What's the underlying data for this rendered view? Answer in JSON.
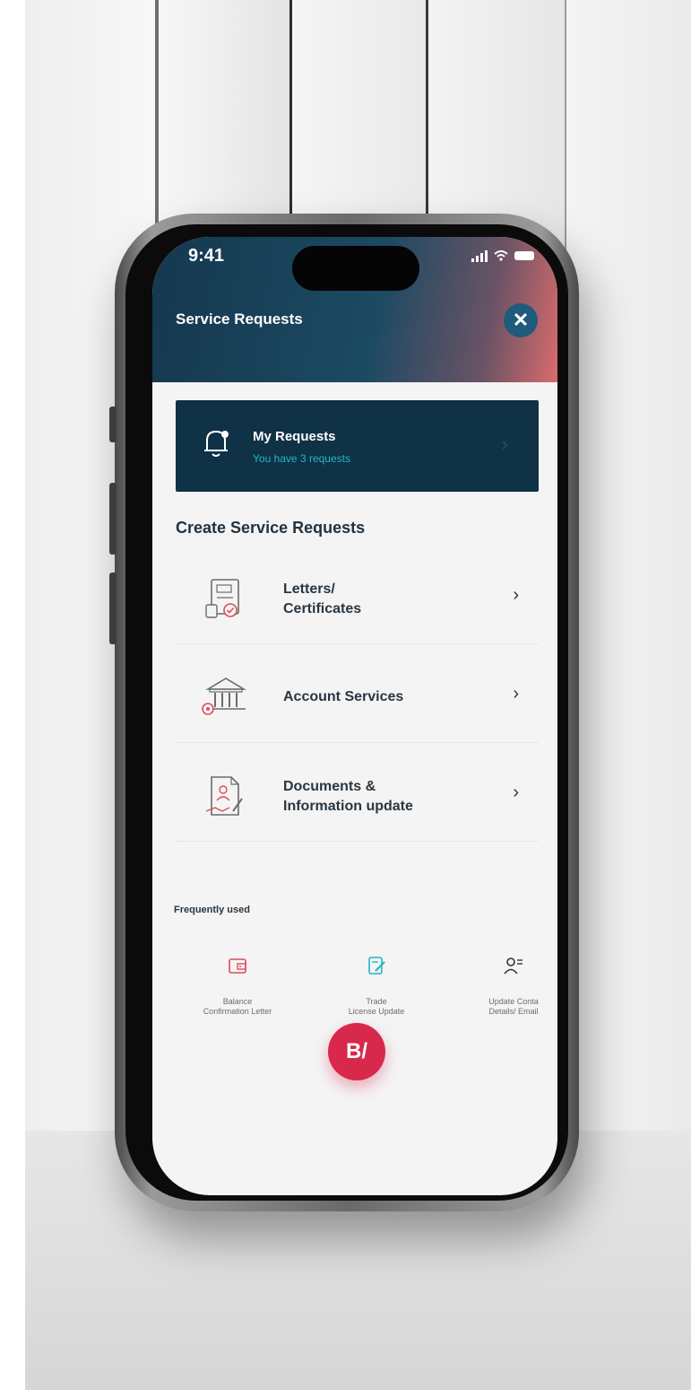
{
  "status_bar": {
    "time": "9:41"
  },
  "header": {
    "title": "Service Requests",
    "close_label": "✕"
  },
  "my_requests": {
    "title": "My Requests",
    "subtitle": "You have 3 requests",
    "chevron": "›"
  },
  "create_section": {
    "title": "Create Service Requests",
    "items": [
      {
        "label_line1": "Letters/",
        "label_line2": "Certificates",
        "icon": "certificate-icon"
      },
      {
        "label_line1": "Account Services",
        "label_line2": "",
        "icon": "bank-icon"
      },
      {
        "label_line1": "Documents &",
        "label_line2": "Information update",
        "icon": "document-edit-icon"
      }
    ],
    "chevron": "›"
  },
  "frequently_used": {
    "title": "Frequently used",
    "items": [
      {
        "line1": "Balance",
        "line2": "Confirmation Letter",
        "icon": "wallet-icon"
      },
      {
        "line1": "Trade",
        "line2": "License Update",
        "icon": "license-edit-icon"
      },
      {
        "line1": "Update Conta",
        "line2": "Details/ Email",
        "icon": "user-contact-icon"
      }
    ]
  },
  "fab": {
    "label": "B/"
  },
  "colors": {
    "header_start": "#15384f",
    "header_end": "#d96b6b",
    "card_bg": "#0f3246",
    "accent_teal": "#1fb7c8",
    "fab_red": "#d8284b"
  }
}
